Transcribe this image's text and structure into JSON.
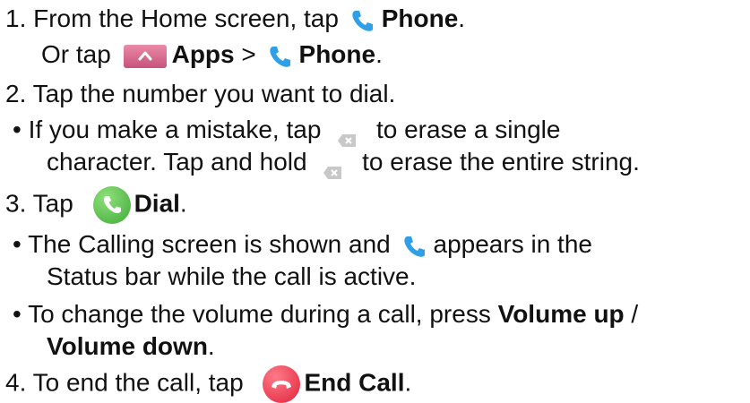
{
  "doc": {
    "lines": [
      {
        "a": "1. From the Home screen, tap ",
        "b": "Phone",
        "c": "."
      },
      {
        "a": "Or tap ",
        "b1": "Apps",
        "mid": " > ",
        "b2": "Phone",
        "c": "."
      },
      {
        "a": "2. Tap the number you want to dial."
      },
      {
        "a": "• If you make a mistake, tap ",
        "c": " to erase a single"
      },
      {
        "a": "character. Tap and hold ",
        "c": " to erase the entire string."
      },
      {
        "a": "3. Tap ",
        "b": "Dial",
        "c": "."
      },
      {
        "a": "• The Calling screen is shown and ",
        "c": "appears in the"
      },
      {
        "a": "Status bar while the call is active."
      },
      {
        "a": "• To change the volume during a call, press ",
        "b": "Volume up",
        "c": " /"
      },
      {
        "b": "Volume down",
        "c": "."
      },
      {
        "a": "4. To end the call, tap ",
        "b": "End Call",
        "c": "."
      }
    ]
  },
  "colors": {
    "phone_blue": "#2f9fe8",
    "apps_pink": "#d7658d",
    "dial_green": "#4cb845",
    "end_red": "#e8344a",
    "delete_gray": "#c8c8c8"
  }
}
